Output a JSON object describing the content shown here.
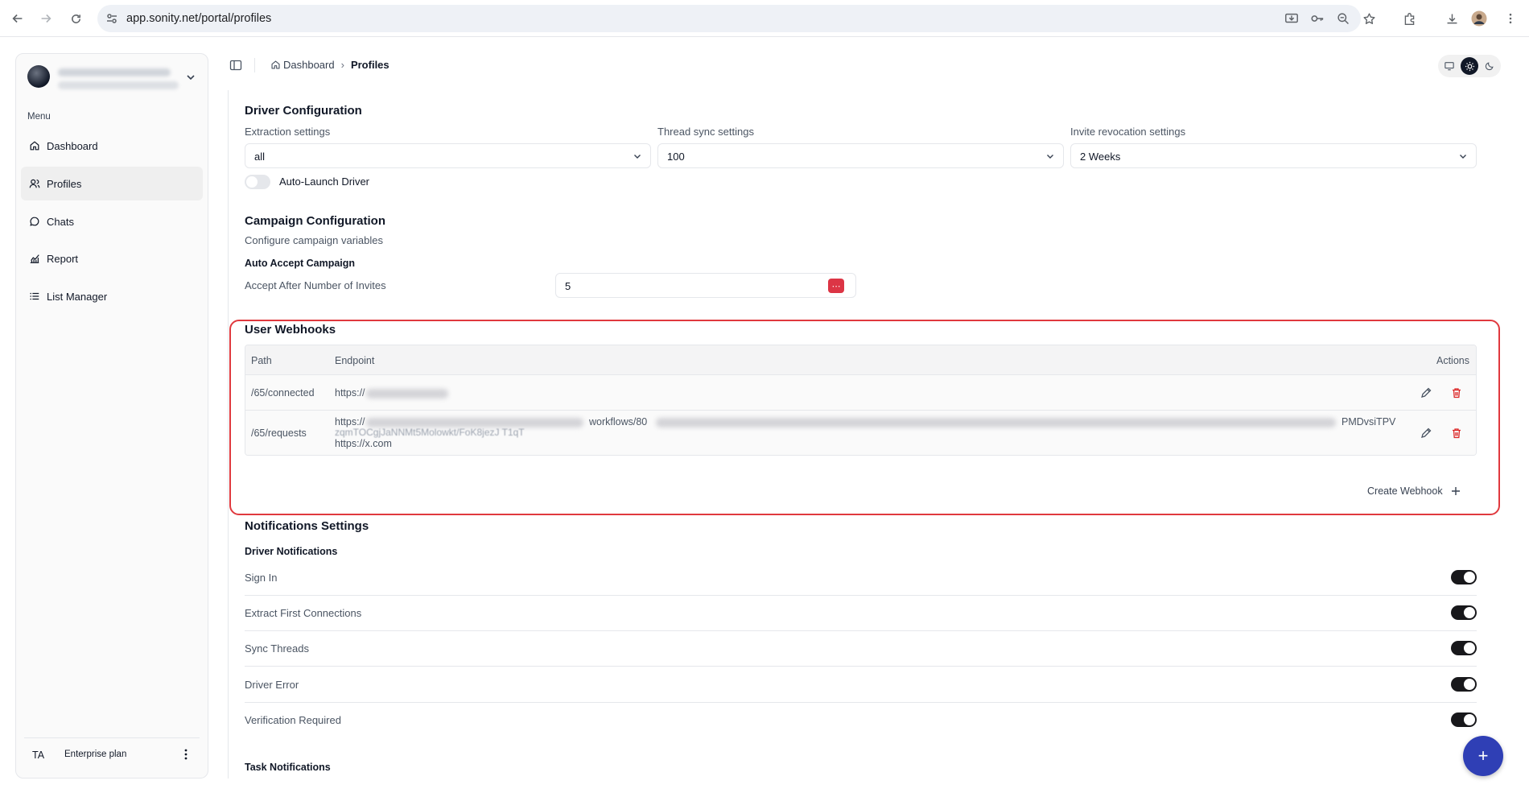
{
  "browser": {
    "url": "app.sonity.net/portal/profiles"
  },
  "sidebar": {
    "menu_label": "Menu",
    "items": [
      {
        "label": "Dashboard",
        "icon": "home-icon"
      },
      {
        "label": "Profiles",
        "icon": "users-icon",
        "active": true
      },
      {
        "label": "Chats",
        "icon": "chat-bubble-icon"
      },
      {
        "label": "Report",
        "icon": "chart-icon"
      },
      {
        "label": "List Manager",
        "icon": "list-icon"
      }
    ],
    "plan": {
      "initials": "TA",
      "name": "Enterprise plan"
    }
  },
  "header": {
    "breadcrumb": [
      "Dashboard",
      "Profiles"
    ]
  },
  "driver_config": {
    "title": "Driver Configuration",
    "extraction_label": "Extraction settings",
    "extraction_value": "all",
    "thread_sync_label": "Thread sync settings",
    "thread_sync_value": "100",
    "invite_revocation_label": "Invite revocation settings",
    "invite_revocation_value": "2 Weeks",
    "auto_launch_label": "Auto-Launch Driver",
    "auto_launch_enabled": false
  },
  "campaign_config": {
    "title": "Campaign Configuration",
    "subtitle": "Configure campaign variables",
    "auto_accept_label": "Auto Accept Campaign",
    "accept_after_label": "Accept After Number of Invites",
    "accept_after_value": "5"
  },
  "webhooks": {
    "title": "User Webhooks",
    "columns": {
      "path": "Path",
      "endpoint": "Endpoint",
      "actions": "Actions"
    },
    "rows": [
      {
        "path": "/65/connected",
        "endpoint_prefix": "https://"
      },
      {
        "path": "/65/requests",
        "endpoint_prefix": "https://",
        "endpoint_mid": "workflows/80",
        "endpoint_tail": "PMDvsiTPV",
        "endpoint_line2": "zqmTOCgjJaNNMt5Molowkt/FoK8jezJ T1qT",
        "endpoint_line3": "https://x.com"
      }
    ],
    "create_label": "Create Webhook"
  },
  "notifications": {
    "title": "Notifications Settings",
    "driver_group": "Driver Notifications",
    "driver_items": [
      {
        "label": "Sign In",
        "enabled": true
      },
      {
        "label": "Extract First Connections",
        "enabled": true
      },
      {
        "label": "Sync Threads",
        "enabled": true
      },
      {
        "label": "Driver Error",
        "enabled": true
      },
      {
        "label": "Verification Required",
        "enabled": true
      }
    ],
    "task_group": "Task Notifications"
  },
  "fab_label": "+"
}
